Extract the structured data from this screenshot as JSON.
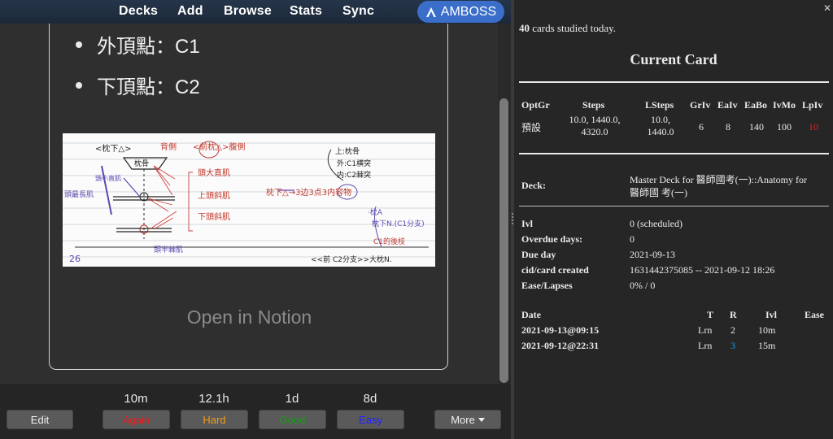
{
  "nav": {
    "decks": "Decks",
    "add": "Add",
    "browse": "Browse",
    "stats": "Stats",
    "sync": "Sync"
  },
  "amboss": {
    "label": "AMBOSS",
    "color": "#3a6ec9"
  },
  "card": {
    "bullets": [
      "外頂點：C1",
      "下頂點：C2"
    ],
    "open_notion": "Open in Notion"
  },
  "sketch": {
    "t_title": "<枕下△>",
    "t_back": "背側",
    "t_ventral": "<前枕△>腹側",
    "t_occ": "枕骨",
    "t_shang": "上:枕骨",
    "t_wai": "外:C1横突",
    "t_nei": "内:C2棘突",
    "t_rect": "頭最長肌",
    "t_rmin": "頭小直肌",
    "t_big": "頭大直肌",
    "t_sup": "上頭斜肌",
    "t_inf": "下頭斜肌",
    "t_mid": "枕下△→3边3点3内容物",
    "t_a": "·枕A",
    "t_n": "枕下N.(C1分支)",
    "t_c1": "C1的後枝",
    "t_semi": "頭半棘肌",
    "t_26": "26",
    "t_bottom": "<<前 C2分支>>大枕N."
  },
  "answers": {
    "again": {
      "label": "Again",
      "ivl": "10m",
      "color": "#e82020"
    },
    "hard": {
      "label": "Hard",
      "ivl": "12.1h",
      "color": "#f39c12"
    },
    "good": {
      "label": "Good",
      "ivl": "1d",
      "color": "#1d9a1d"
    },
    "easy": {
      "label": "Easy",
      "ivl": "8d",
      "color": "#2222ff"
    }
  },
  "buttons": {
    "edit": "Edit",
    "more": "More"
  },
  "info": {
    "studied_count": "40",
    "studied_text": " cards studied today.",
    "heading": "Current Card",
    "options": {
      "headers": [
        "OptGr",
        "Steps",
        "LSteps",
        "GrIv",
        "EaIv",
        "EaBo",
        "IvMo",
        "LpIv"
      ],
      "optgr": "預設",
      "steps": [
        "10.0, 1440.0,",
        "4320.0"
      ],
      "lsteps": [
        "10.0,",
        "1440.0"
      ],
      "griv": "6",
      "eaiv": "8",
      "eabo": "140",
      "ivmo": "100",
      "lpiv": "10",
      "lpiv_color": "#e02020"
    },
    "deck_label": "Deck:",
    "deck_value": [
      "Master Deck for 醫師國考(一)::Anatomy for",
      "醫師國 考(一)"
    ],
    "fields": [
      {
        "label": "Ivl",
        "value": "0 (scheduled)"
      },
      {
        "label": "Overdue days:",
        "value": "0"
      },
      {
        "label": "Due day",
        "value": "2021-09-13"
      },
      {
        "label": "cid/card created",
        "value": "1631442375085  --  2021-09-12 18:26"
      },
      {
        "label": "Ease/Lapses",
        "value": "0% / 0"
      }
    ],
    "reviews": {
      "headers": [
        "Date",
        "T",
        "R",
        "Ivl",
        "Ease"
      ],
      "rows": [
        {
          "date": "2021-09-13@09:15",
          "t": "Lrn",
          "r": "2",
          "ivl": "10m",
          "ease": ""
        },
        {
          "date": "2021-09-12@22:31",
          "t": "Lrn",
          "r": "3",
          "ivl": "15m",
          "ease": ""
        }
      ],
      "r3_color": "#1aa0e0"
    }
  }
}
